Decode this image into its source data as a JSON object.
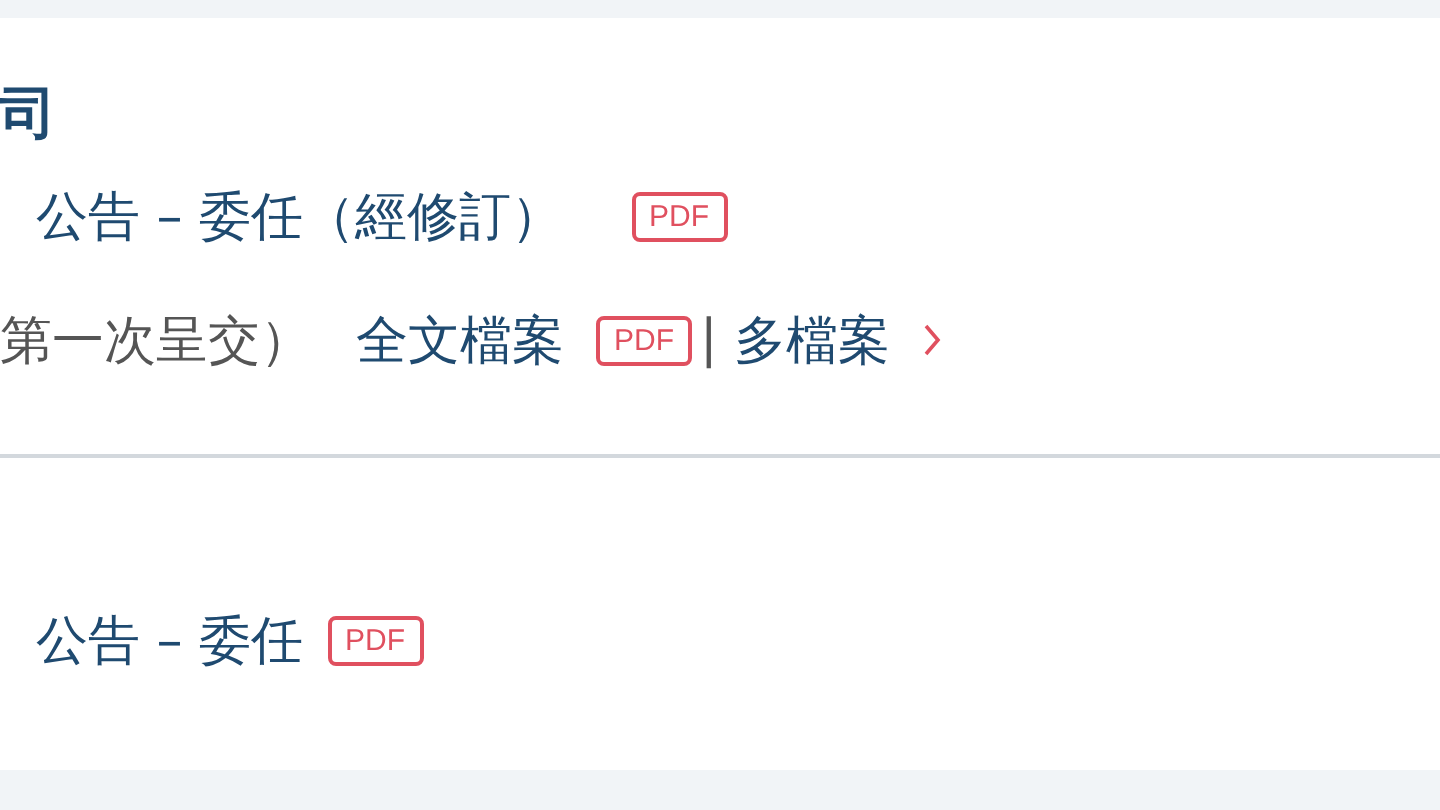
{
  "sections": [
    {
      "title": "司",
      "items": [
        {
          "kind": "document",
          "label": "公告 – 委任（經修訂）",
          "badge": "PDF"
        },
        {
          "kind": "submission",
          "note": "第一次呈交）",
          "link": "全文檔案",
          "badge": "PDF",
          "separator": "|",
          "more": "多檔案"
        }
      ]
    },
    {
      "items": [
        {
          "kind": "document",
          "label": "公告 – 委任",
          "badge": "PDF"
        }
      ]
    }
  ]
}
